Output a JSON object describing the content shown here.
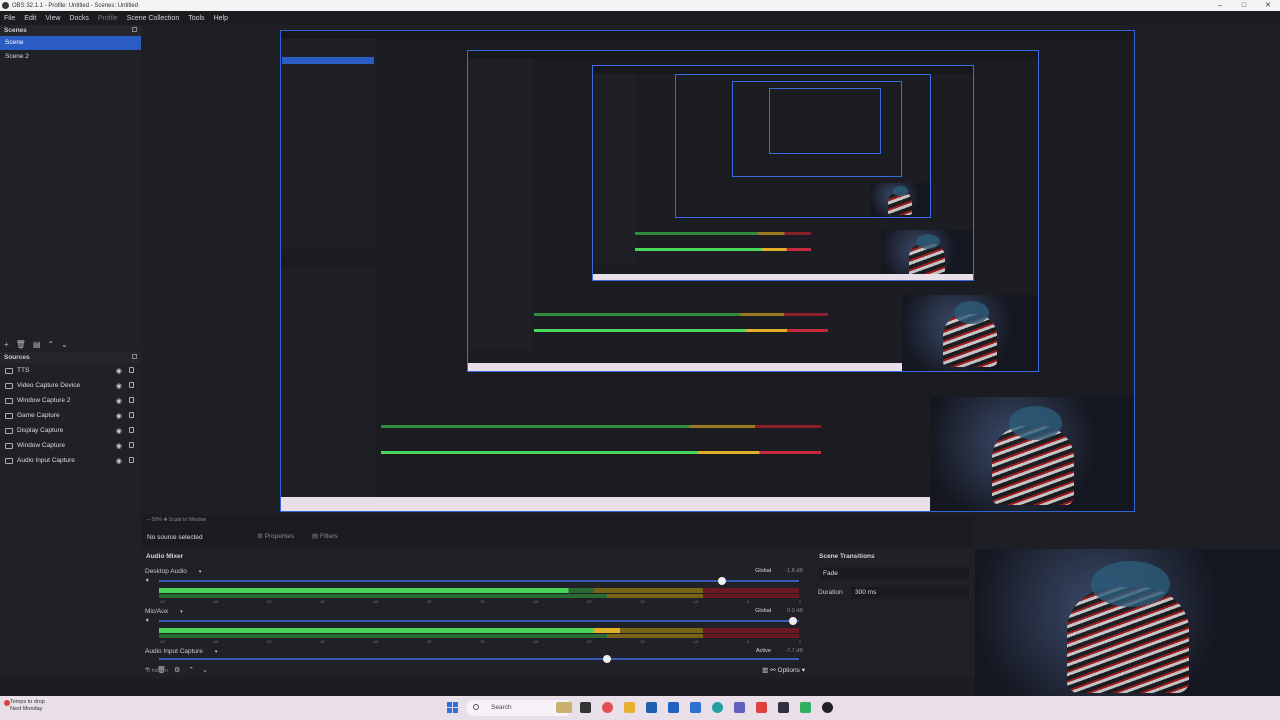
{
  "window": {
    "title": "OBS 32.1.1 - Profile: Untitled - Scenes: Untitled",
    "controls": [
      "–",
      "□",
      "✕"
    ]
  },
  "menu": [
    "File",
    "Edit",
    "View",
    "Docks",
    "Profile",
    "Scene Collection",
    "Tools",
    "Help"
  ],
  "scenes": {
    "title": "Scenes",
    "items": [
      "Scene",
      "Scene 2"
    ]
  },
  "sources": {
    "title": "Sources",
    "items": [
      {
        "label": "TTS",
        "icon": "text-icon"
      },
      {
        "label": "Video Capture Device",
        "icon": "camera-icon"
      },
      {
        "label": "Window Capture 2",
        "icon": "window-icon"
      },
      {
        "label": "Game Capture",
        "icon": "gamepad-icon"
      },
      {
        "label": "Display Capture",
        "icon": "monitor-icon"
      },
      {
        "label": "Window Capture",
        "icon": "window-icon"
      },
      {
        "label": "Audio Input Capture",
        "icon": "mic-icon"
      }
    ]
  },
  "source_bar": {
    "zoom_info": "─ 50% ✚ Scale to Window",
    "no_source": "No source selected",
    "properties": "Properties",
    "filters": "Filters"
  },
  "mixer": {
    "title": "Audio Mixer",
    "channels": [
      {
        "name": "Desktop Audio",
        "badge": "Global",
        "db": "-1.8 dB",
        "level": 0.64,
        "fader": 0.88
      },
      {
        "name": "Mic/Aux",
        "badge": "Global",
        "db": "0.0 dB",
        "level": 0.72,
        "fader": 0.99
      },
      {
        "name": "Audio Input Capture",
        "badge": "Active",
        "db": "-7.7 dB",
        "level": 0.0,
        "fader": 0.7
      }
    ],
    "ticks": [
      "-60",
      "-55",
      "-50",
      "-45",
      "-40",
      "-35",
      "-30",
      "-25",
      "-20",
      "-15",
      "-10",
      "-5",
      "0"
    ],
    "hidden": "0 hidden",
    "options": "Options"
  },
  "transitions": {
    "title": "Scene Transitions",
    "selected": "Fade",
    "duration_label": "Duration",
    "duration_value": "300 ms"
  },
  "taskbar": {
    "weather_line1": "Temps to drop",
    "weather_line2": "Next Monday",
    "search_placeholder": "Search"
  }
}
